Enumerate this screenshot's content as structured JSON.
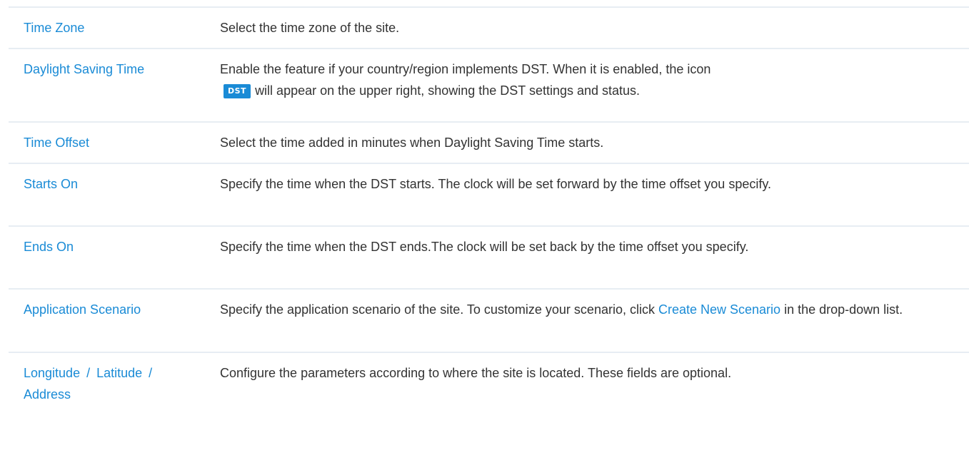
{
  "rows": [
    {
      "term": "Time Zone",
      "desc": "Select the time zone of the site."
    },
    {
      "term": "Daylight Saving Time",
      "desc_before": "Enable the feature if your country/region implements DST. When it is enabled, the icon",
      "badge": "DST",
      "desc_after": "will appear on the upper right, showing the DST settings and status."
    },
    {
      "term": "Time Offset",
      "desc": "Select the time added in minutes when Daylight Saving Time starts."
    },
    {
      "term": "Starts On",
      "desc": "Specify the time when the DST starts. The clock will be set forward by the time offset you specify."
    },
    {
      "term": "Ends On",
      "desc": "Specify the time when the DST ends.The clock will be set back by the time offset you specify."
    },
    {
      "term": "Application Scenario",
      "desc_before": "Specify the application scenario of the site. To customize your scenario, click",
      "link": "Create New Scenario",
      "desc_after": "in the drop-down list."
    },
    {
      "term": "Longitude / Latitude / Address",
      "desc": "Configure the parameters according to where the site is located. These fields are optional."
    }
  ],
  "colors": {
    "term": "#1a8bd6",
    "text": "#333333",
    "divider": "#e7edf3",
    "badge_bg": "#1a8bd6"
  }
}
